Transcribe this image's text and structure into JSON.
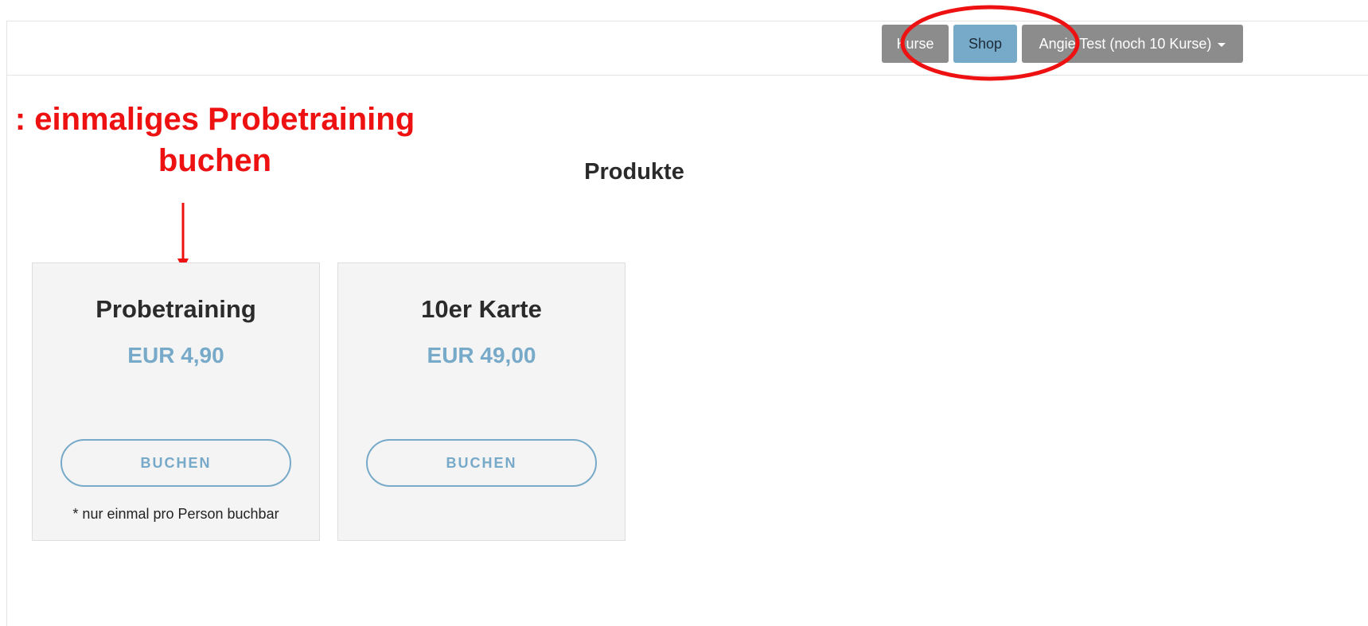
{
  "navbar": {
    "kurse_label": "Kurse",
    "shop_label": "Shop",
    "user_label": "Angie Test (noch 10 Kurse)"
  },
  "annotation": {
    "text_line1": ": einmaliges Probetraining",
    "text_line2": "buchen",
    "color": "#ee1111"
  },
  "main": {
    "title": "Produkte",
    "products": [
      {
        "title": "Probetraining",
        "price": "EUR 4,90",
        "button_label": "BUCHEN",
        "note": "* nur einmal pro Person buchbar"
      },
      {
        "title": "10er Karte",
        "price": "EUR 49,00",
        "button_label": "BUCHEN",
        "note": ""
      }
    ]
  },
  "colors": {
    "accent": "#77a9c9",
    "nav_gray": "#8c8c8c",
    "card_bg": "#f4f4f4"
  }
}
